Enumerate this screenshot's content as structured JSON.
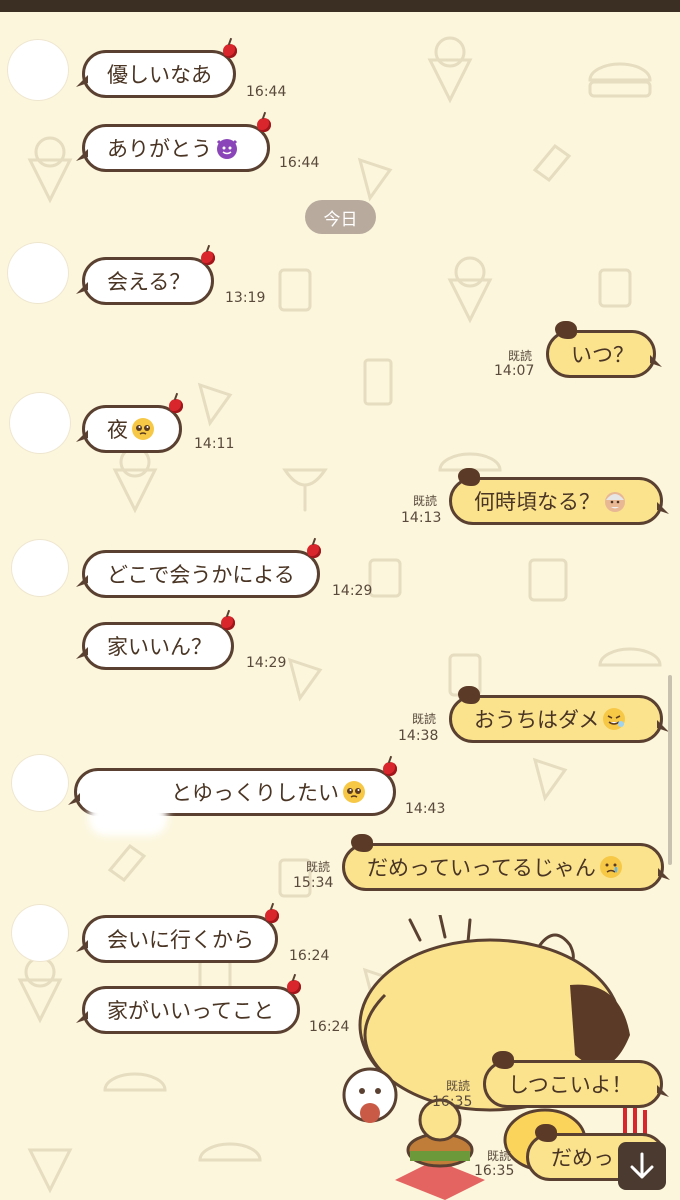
{
  "colors": {
    "background": "#fbf6dc",
    "incoming_bubble": "#ffffff",
    "outgoing_bubble": "#fbe38e",
    "bubble_border": "#5a4030",
    "date_pill": "#b8ab9e"
  },
  "date_divider": "今日",
  "messages": [
    {
      "text": "優しいなあ",
      "time": "16:44"
    },
    {
      "text": "ありがとう",
      "emoji": "smiling-devil-icon",
      "time": "16:44"
    },
    {
      "text": "会える？",
      "time": "13:19"
    },
    {
      "text": "いつ？",
      "time": "14:07",
      "read": "既読"
    },
    {
      "text": "夜",
      "emoji": "pleading-face-icon",
      "time": "14:11"
    },
    {
      "text": "何時頃なる？",
      "emoji": "old-man-icon",
      "time": "14:13",
      "read": "既読"
    },
    {
      "text": "どこで会うかによる",
      "time": "14:29"
    },
    {
      "text": "家いいん？",
      "time": "14:29"
    },
    {
      "text": "おうちはダメ",
      "emoji": "face-with-tongue-icon",
      "time": "14:38",
      "read": "既読"
    },
    {
      "text": "とゆっくりしたい",
      "emoji": "pleading-face-icon",
      "time": "14:43"
    },
    {
      "text": "だめっていってるじゃん",
      "emoji": "crying-face-icon",
      "time": "15:34",
      "read": "既読"
    },
    {
      "text": "会いに行くから",
      "time": "16:24"
    },
    {
      "text": "家がいいってこと",
      "time": "16:24"
    },
    {
      "text": "しつこいよ！",
      "time": "16:35",
      "read": "既読"
    },
    {
      "text": "だめっ",
      "time": "16:35",
      "read": "既読"
    }
  ]
}
